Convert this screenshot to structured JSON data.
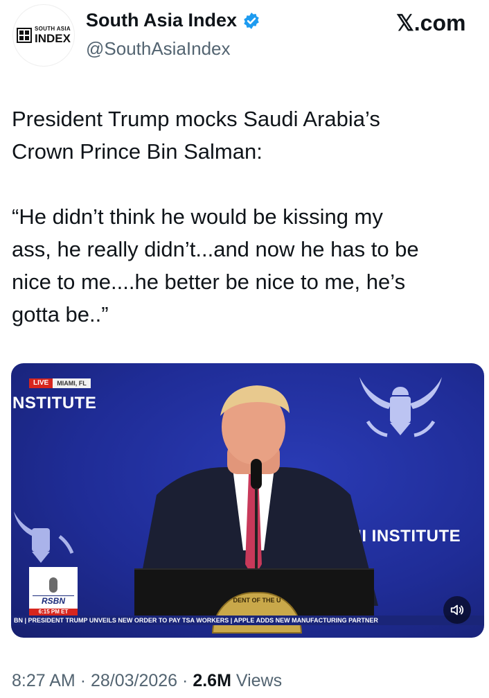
{
  "header": {
    "avatar": {
      "logo_small": "SOUTH ASIA",
      "logo_big": "INDEX"
    },
    "display_name": "South Asia Index",
    "handle": "@SouthAsiaIndex",
    "verified_icon": "verified-badge-icon",
    "brand": "𝕏.com"
  },
  "tweet": {
    "text": "President Trump mocks Saudi Arabia’s\nCrown Prince Bin Salman:\n\n“He didn’t think he would be kissing my\nass, he really didn’t...and now he has to be\nnice to me....he better be nice to me, he’s\ngotta be..”"
  },
  "media": {
    "live_label": "LIVE",
    "location": "MIAMI, FL",
    "banner_top": "NSTITUTE",
    "banner_right": "FII INSTITUTE",
    "rsbn_label": "RSBN",
    "time_label": "6:15 PM ET",
    "seal_text": "DENT OF THE U",
    "ticker": "BN | PRESIDENT TRUMP UNVEILS NEW ORDER TO PAY TSA WORKERS | APPLE ADDS NEW MANUFACTURING PARTNER",
    "sound_icon": "speaker-icon"
  },
  "meta": {
    "time": "8:27 AM",
    "sep1": "·",
    "date": "28/03/2026",
    "sep2": "·",
    "views_count": "2.6M",
    "views_label": "Views"
  },
  "colors": {
    "verified_blue": "#1d9bf0",
    "media_blue": "#1f2c96",
    "live_red": "#d7261e",
    "secondary_text": "#536471"
  }
}
